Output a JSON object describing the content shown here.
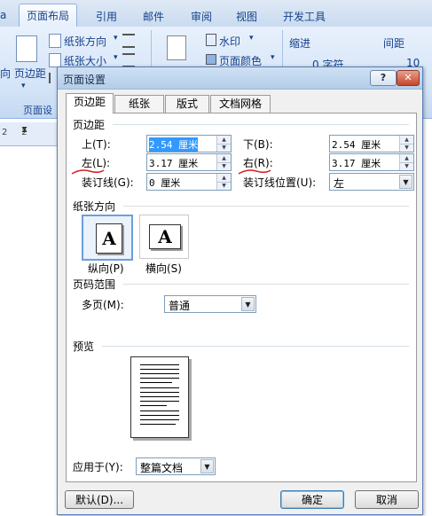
{
  "ribbon": {
    "tabs": [
      "页面布局",
      "引用",
      "邮件",
      "审阅",
      "视图",
      "开发工具"
    ],
    "left_fragment": "a",
    "items": {
      "orientation": "纸张方向",
      "size": "纸张大小",
      "margins_fragment": "向 页边距",
      "page_setup_group": "页面设",
      "watermark": "水印",
      "page_color": "页面颜色",
      "indent": "缩进",
      "spacing": "间距",
      "indent_value": "0 字符",
      "spacing_value": "10"
    },
    "ruler_text": "2     2"
  },
  "dialog": {
    "title": "页面设置",
    "help_label": "?",
    "close_label": "✕",
    "tabs": [
      "页边距",
      "纸张",
      "版式",
      "文档网格"
    ],
    "margins": {
      "section_label": "页边距",
      "top_label": "上(T):",
      "top_value": "2.54 厘米",
      "bottom_label": "下(B):",
      "bottom_value": "2.54 厘米",
      "left_label": "左(L):",
      "left_value": "3.17 厘米",
      "right_label": "右(R):",
      "right_value": "3.17 厘米",
      "gutter_label": "装订线(G):",
      "gutter_value": "0 厘米",
      "gutter_pos_label": "装订线位置(U):",
      "gutter_pos_value": "左"
    },
    "orientation": {
      "section_label": "纸张方向",
      "portrait_label": "纵向(P)",
      "landscape_label": "横向(S)",
      "icon_letter": "A"
    },
    "pages": {
      "section_label": "页码范围",
      "multiple_label": "多页(M):",
      "multiple_value": "普通"
    },
    "preview": {
      "section_label": "预览"
    },
    "apply_to": {
      "label": "应用于(Y):",
      "value": "整篇文档"
    },
    "buttons": {
      "default": "默认(D)...",
      "ok": "确定",
      "cancel": "取消"
    }
  }
}
